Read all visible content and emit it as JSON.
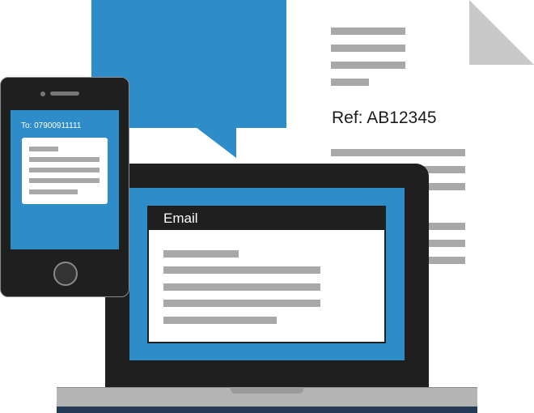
{
  "document": {
    "reference": "Ref: AB12345"
  },
  "phone": {
    "recipient": "To: 07900911111"
  },
  "laptop": {
    "email_window_title": "Email"
  },
  "colors": {
    "accent_blue": "#2e8cc9",
    "device_black": "#1f1f1f",
    "placeholder_gray": "#a8a8a8",
    "base_navy": "#243a55"
  },
  "icons": [
    "document-icon",
    "speech-bubble-icon",
    "laptop-icon",
    "mobile-phone-icon"
  ]
}
